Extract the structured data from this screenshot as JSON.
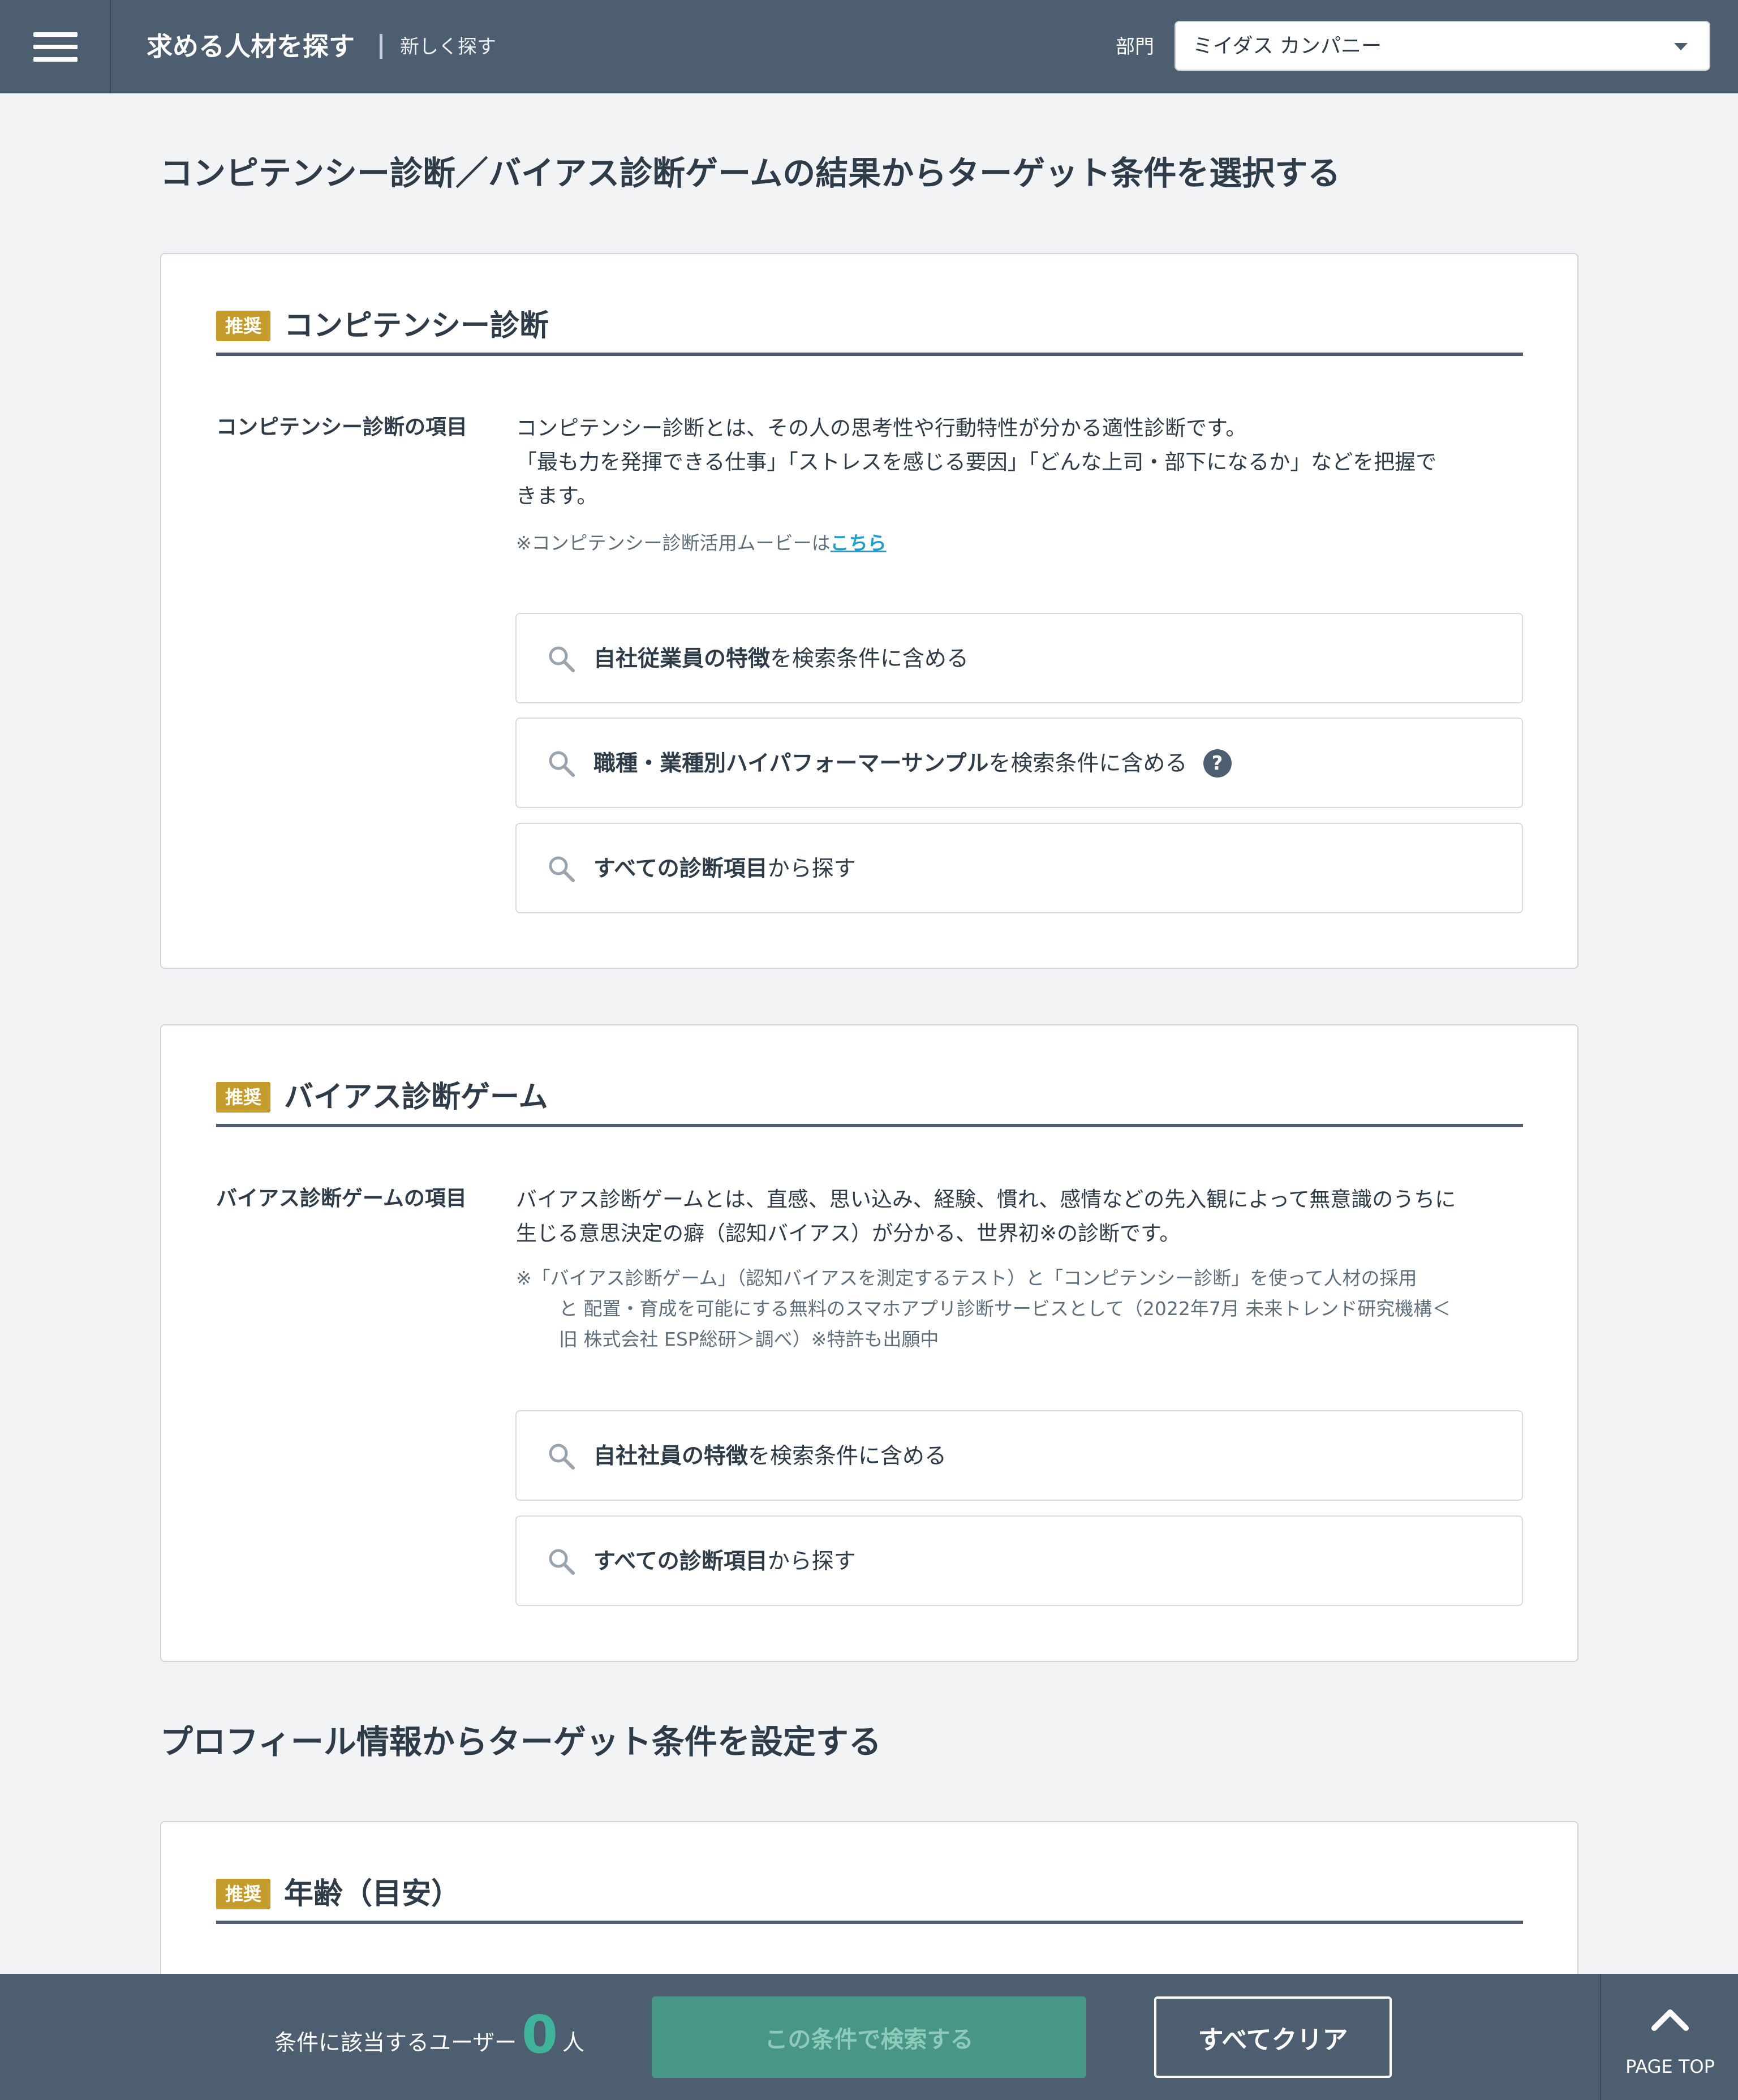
{
  "header": {
    "title": "求める人材を探す",
    "subtitle": "新しく探す",
    "department_label": "部門",
    "department_value": "ミイダス カンパニー"
  },
  "sections": {
    "diagnosis_heading": "コンピテンシー診断／バイアス診断ゲームの結果からターゲット条件を選択する",
    "profile_heading": "プロフィール情報からターゲット条件を設定する"
  },
  "competency": {
    "badge": "推奨",
    "title": "コンピテンシー診断",
    "item_label": "コンピテンシー診断の項目",
    "desc_line1": "コンピテンシー診断とは、その人の思考性や行動特性が分かる適性診断です。",
    "desc_line2": "「最も力を発揮できる仕事」「ストレスを感じる要因」「どんな上司・部下になるか」などを把握で",
    "desc_line3": "きます。",
    "movie_note": "※コンピテンシー診断活用ムービーは",
    "movie_link": "こちら",
    "options": [
      {
        "bold": "自社従業員の特徴",
        "rest": "を検索条件に含める"
      },
      {
        "bold": "職種・業種別ハイパフォーマーサンプル",
        "rest": "を検索条件に含める",
        "help": "?"
      },
      {
        "bold": "すべての診断項目",
        "rest": "から探す"
      }
    ]
  },
  "bias": {
    "badge": "推奨",
    "title": "バイアス診断ゲーム",
    "item_label": "バイアス診断ゲームの項目",
    "desc_line1": "バイアス診断ゲームとは、直感、思い込み、経験、慣れ、感情などの先入観によって無意識のうちに",
    "desc_line2": "生じる意思決定の癖（認知バイアス）が分かる、世界初※の診断です。",
    "note_line1": "※「バイアス診断ゲーム」（認知バイアスを測定するテスト）と「コンピテンシー診断」を使って人材の採用",
    "note_line2": "と 配置・育成を可能にする無料のスマホアプリ診断サービスとして（2022年7月 未来トレンド研究機構＜",
    "note_line3": "旧 株式会社 ESP総研＞調べ）※特許も出願中",
    "options": [
      {
        "bold": "自社社員の特徴",
        "rest": "を検索条件に含める"
      },
      {
        "bold": "すべての診断項目",
        "rest": "から探す"
      }
    ]
  },
  "age": {
    "badge": "推奨",
    "title": "年齢（目安）"
  },
  "footer": {
    "count_label": "条件に該当するユーザー",
    "count": "0",
    "count_unit": "人",
    "search_button": "この条件で検索する",
    "clear_button": "すべてクリア",
    "page_top": "PAGE TOP"
  },
  "colors": {
    "header_bg": "#4d5e70",
    "badge": "#c59b2b",
    "link": "#1b9fd1",
    "count": "#40b49a",
    "search_button": "#479686"
  },
  "icons": [
    "menu-icon",
    "caret-down-icon",
    "search-icon",
    "help-icon",
    "chevron-up-icon"
  ]
}
